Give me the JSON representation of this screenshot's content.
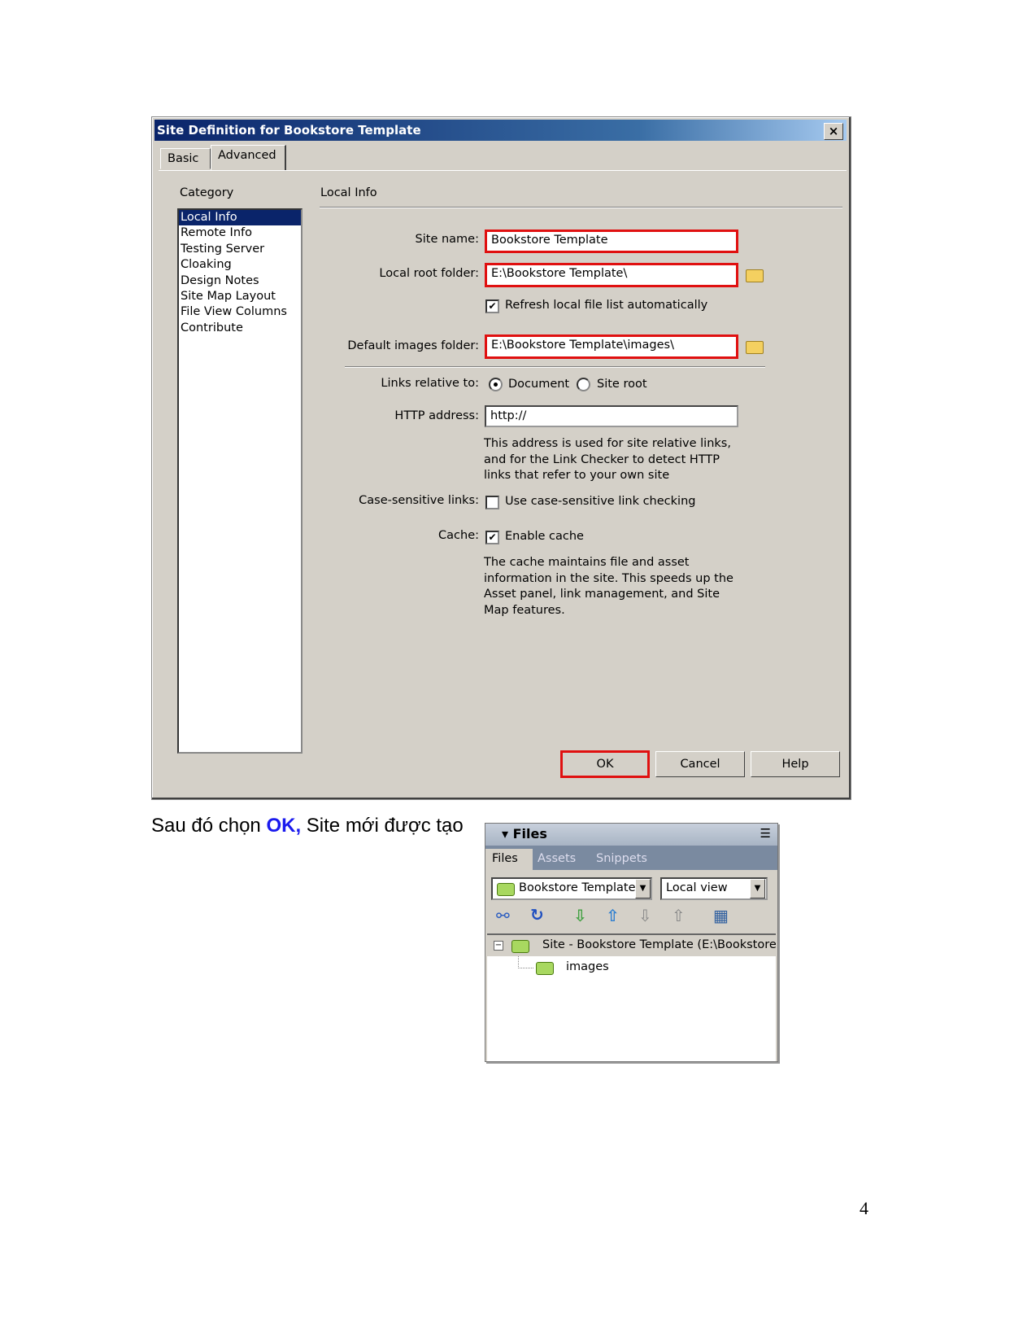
{
  "dialog": {
    "title": "Site Definition for Bookstore Template",
    "close": "×",
    "tabs": [
      "Basic",
      "Advanced"
    ],
    "category_label": "Category",
    "categories": [
      "Local Info",
      "Remote Info",
      "Testing Server",
      "Cloaking",
      "Design Notes",
      "Site Map Layout",
      "File View Columns",
      "Contribute"
    ],
    "section": "Local Info",
    "site_name_label": "Site name:",
    "site_name": "Bookstore Template",
    "local_root_label": "Local root folder:",
    "local_root": "E:\\Bookstore Template\\",
    "refresh_label": "Refresh local file list automatically",
    "refresh_checked": true,
    "images_label": "Default images folder:",
    "images": "E:\\Bookstore Template\\images\\",
    "links_label": "Links relative to:",
    "links_options": [
      "Document",
      "Site root"
    ],
    "links_selected": "Document",
    "http_label": "HTTP address:",
    "http": "http://",
    "http_help": [
      "This address is used for site relative links,",
      "and for the Link Checker to detect HTTP",
      "links that refer to your own site"
    ],
    "case_label": "Case-sensitive links:",
    "case_option": "Use case-sensitive link checking",
    "case_checked": false,
    "cache_label": "Cache:",
    "cache_option": "Enable cache",
    "cache_checked": true,
    "cache_help": [
      "The cache maintains file and asset",
      "information in the site.  This speeds up the",
      "Asset panel, link management, and Site",
      "Map features."
    ],
    "buttons": {
      "ok": "OK",
      "cancel": "Cancel",
      "help": "Help"
    },
    "highlight_color": "#e01010"
  },
  "caption": {
    "before": "Sau đó chọn ",
    "ok": "OK,",
    "after": " Site mới được tạo",
    "ok_color": "#1a1aee"
  },
  "files_panel": {
    "title": "Files",
    "tabs": [
      "Files",
      "Assets",
      "Snippets"
    ],
    "site_select": "Bookstore Template",
    "view_select": "Local view",
    "toolbar_icons": [
      "connect-icon",
      "refresh-icon",
      "get-icon",
      "put-icon",
      "check-out-icon",
      "check-in-icon",
      "expand-icon"
    ],
    "tree": {
      "root": "Site - Bookstore Template (E:\\Bookstore",
      "children": [
        "images"
      ]
    }
  },
  "page_number": "4"
}
